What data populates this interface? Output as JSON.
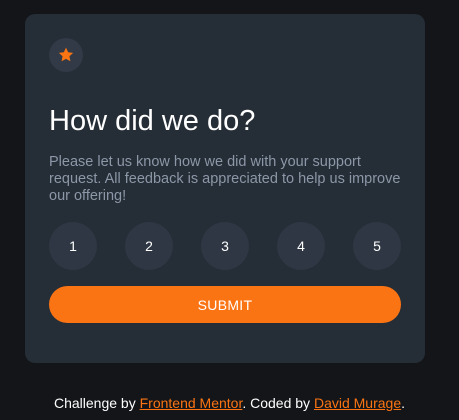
{
  "card": {
    "icon": "star-icon",
    "title": "How did we do?",
    "description": "Please let us know how we did with your support request. All feedback is appreciated to help us improve our offering!",
    "ratings": [
      "1",
      "2",
      "3",
      "4",
      "5"
    ],
    "submit_label": "SUBMIT"
  },
  "footer": {
    "prefix": "Challenge by ",
    "challenge_link": "Frontend Mentor",
    "middle": ". Coded by ",
    "author_link": "David Murage",
    "suffix": "."
  },
  "colors": {
    "background": "#131518",
    "card": "#252d37",
    "accent": "#fb7413",
    "muted_text": "#8c97a7",
    "rating_bg": "#2e3743"
  }
}
